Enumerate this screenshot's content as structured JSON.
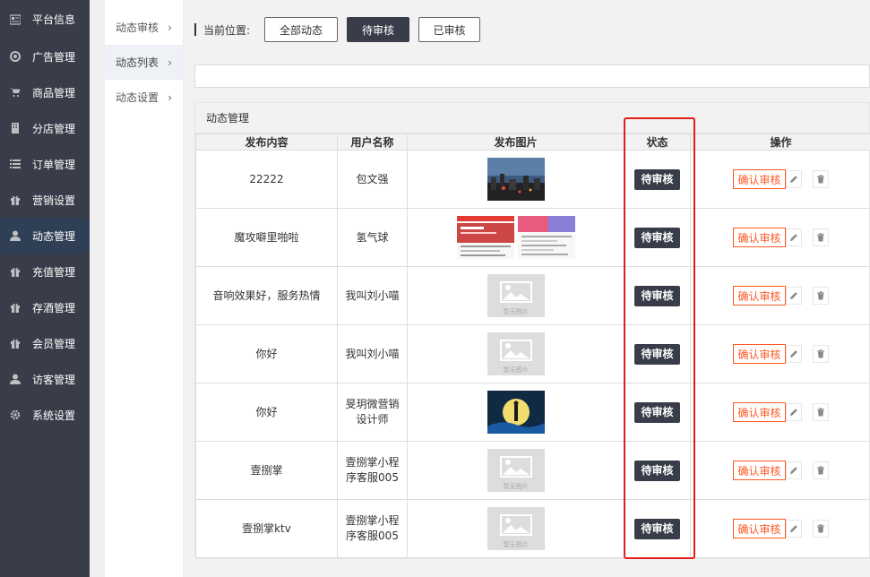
{
  "sidebar": {
    "items": [
      {
        "label": "平台信息",
        "icon": "info-card-icon"
      },
      {
        "label": "广告管理",
        "icon": "lifebuoy-icon"
      },
      {
        "label": "商品管理",
        "icon": "cart-icon"
      },
      {
        "label": "分店管理",
        "icon": "building-icon"
      },
      {
        "label": "订单管理",
        "icon": "list-icon"
      },
      {
        "label": "营销设置",
        "icon": "gift-icon"
      },
      {
        "label": "动态管理",
        "icon": "user-icon",
        "active": true
      },
      {
        "label": "充值管理",
        "icon": "gift-icon"
      },
      {
        "label": "存酒管理",
        "icon": "gift-icon"
      },
      {
        "label": "会员管理",
        "icon": "gift-icon"
      },
      {
        "label": "访客管理",
        "icon": "user-icon"
      },
      {
        "label": "系统设置",
        "icon": "gear-icon"
      }
    ]
  },
  "subnav": {
    "items": [
      {
        "label": "动态审核",
        "arrow": "›"
      },
      {
        "label": "动态列表",
        "arrow": "›",
        "active": true
      },
      {
        "label": "动态设置",
        "arrow": "›"
      }
    ]
  },
  "filter": {
    "label": "当前位置:",
    "buttons": [
      {
        "label": "全部动态"
      },
      {
        "label": "待审核",
        "active": true
      },
      {
        "label": "已审核"
      }
    ]
  },
  "panel": {
    "title": "动态管理",
    "columns": [
      "发布内容",
      "用户名称",
      "发布图片",
      "状态",
      "操作"
    ],
    "rows": [
      {
        "content": "22222",
        "user": "包文强",
        "images": [
          "city-night"
        ],
        "status": "待审核"
      },
      {
        "content": "魔攻噼里啪啦",
        "user": "氢气球",
        "images": [
          "screenshot-red",
          "screenshot-pink"
        ],
        "status": "待审核"
      },
      {
        "content": "音响效果好，服务热情",
        "user": "我叫刘小喵",
        "images": [
          "placeholder"
        ],
        "status": "待审核"
      },
      {
        "content": "你好",
        "user": "我叫刘小喵",
        "images": [
          "placeholder"
        ],
        "status": "待审核"
      },
      {
        "content": "你好",
        "user": "旻玥微营销设计师",
        "images": [
          "moon-poster"
        ],
        "status": "待审核"
      },
      {
        "content": "壹捌掌",
        "user": "壹捌掌小程序客服005",
        "images": [
          "placeholder"
        ],
        "status": "待审核"
      },
      {
        "content": "壹捌掌ktv",
        "user": "壹捌掌小程序客服005",
        "images": [
          "placeholder"
        ],
        "status": "待审核"
      }
    ],
    "confirm_label": "确认审核",
    "placeholder_text": "暂无图片"
  },
  "colors": {
    "sidebar_bg": "#393d49",
    "sidebar_active": "#2f4056",
    "badge_bg": "#393d49",
    "confirm": "#ff5722",
    "highlight_box": "#e31b1b"
  }
}
